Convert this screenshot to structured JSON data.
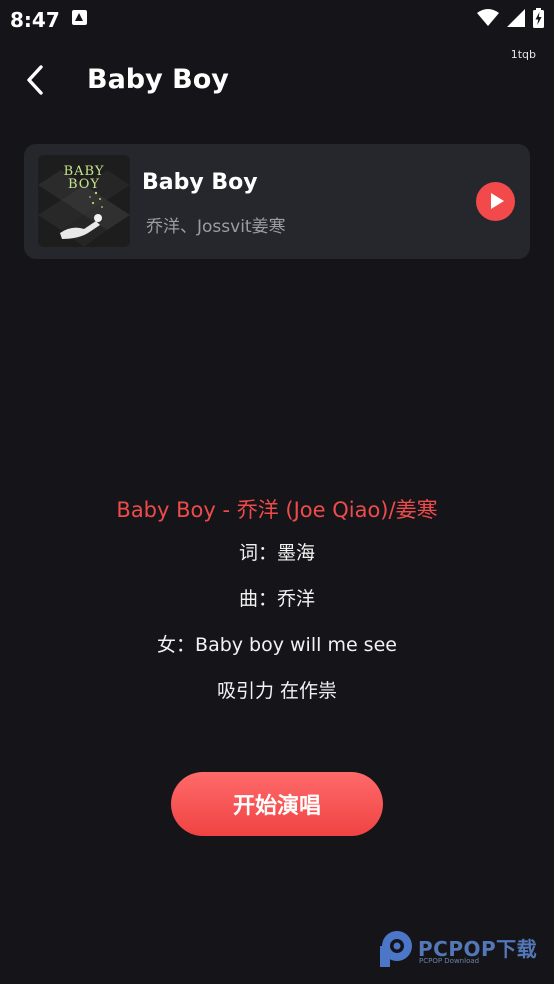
{
  "status_bar": {
    "time": "8:47",
    "icons": [
      "a-notification-icon",
      "wifi-icon",
      "signal-icon",
      "battery-charging-icon"
    ],
    "watermark": "1tqb"
  },
  "header": {
    "title": "Baby Boy",
    "back_icon": "chevron-left-icon"
  },
  "song_card": {
    "title": "Baby Boy",
    "artist": "乔洋、Jossvit姜寒",
    "cover_text_1": "BABY",
    "cover_text_2": "BOY",
    "play_icon": "play-icon"
  },
  "lyrics": {
    "title": "Baby Boy - 乔洋 (Joe Qiao)/姜寒",
    "lines": [
      "词：墨海",
      "曲：乔洋",
      "女：Baby boy will me see",
      "吸引力  在作祟"
    ]
  },
  "actions": {
    "start_label": "开始演唱"
  },
  "watermark": {
    "text": "PCPOP下载",
    "sub": "PCPOP Download"
  },
  "colors": {
    "background": "#151519",
    "card": "#26262d",
    "accent": "#f04343",
    "lyric_title": "#ee4b4b"
  }
}
